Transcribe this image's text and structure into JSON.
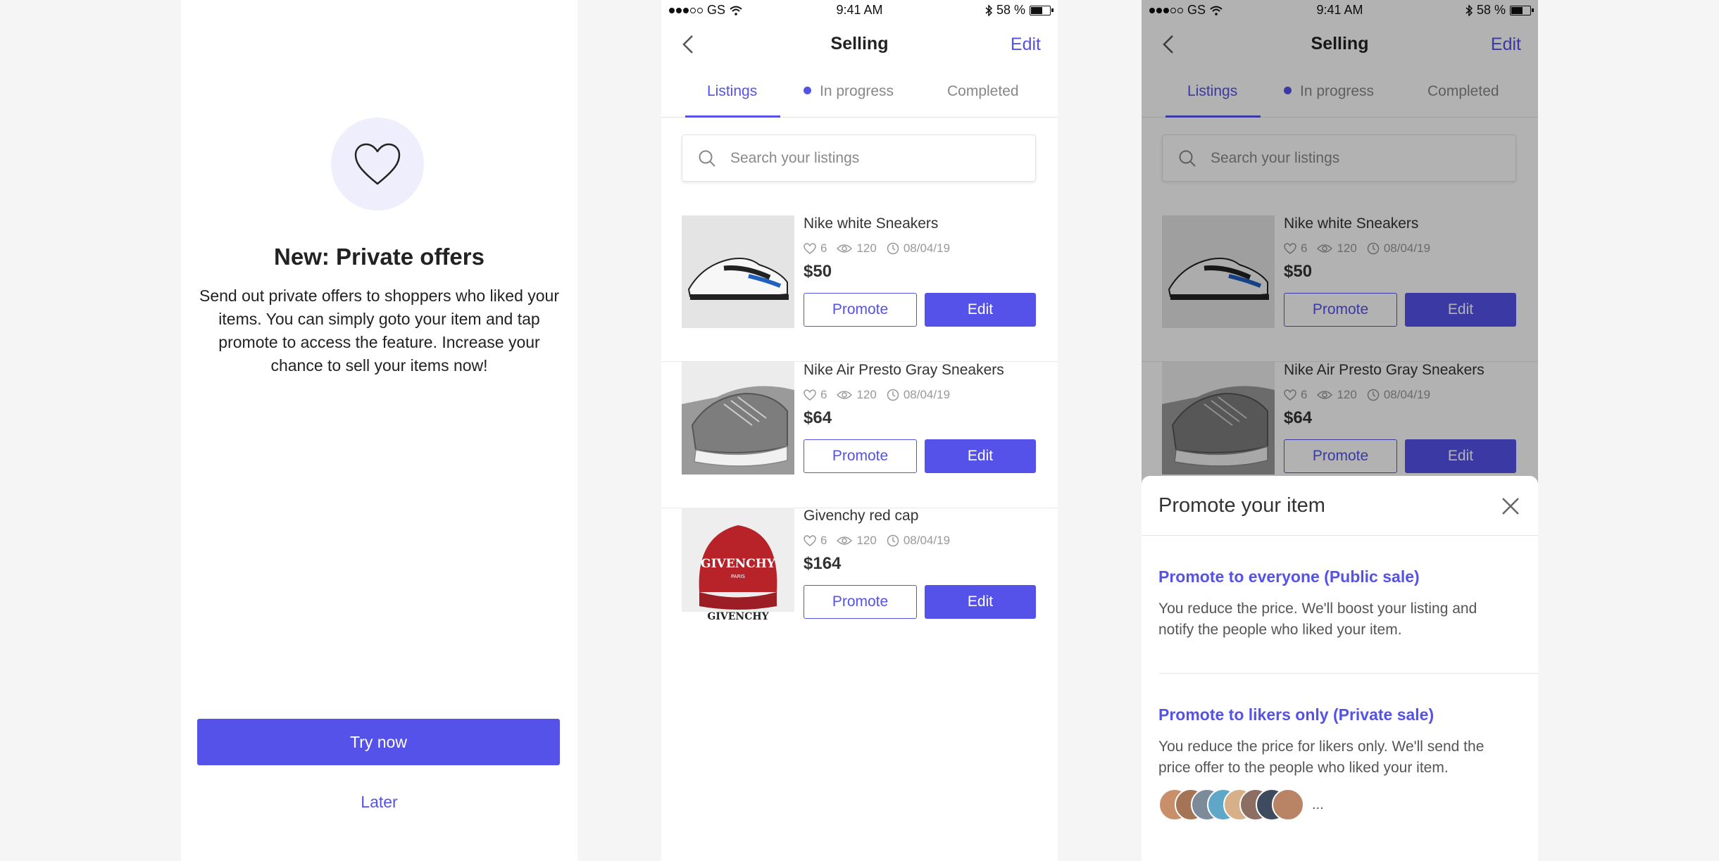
{
  "screen1": {
    "title": "New: Private offers",
    "body": "Send out private offers to shoppers who liked your items. You can simply goto your item and tap promote to access the feature. Increase your chance to sell your items now!",
    "primary_button": "Try now",
    "secondary_button": "Later",
    "icon": "heart-icon"
  },
  "status_bar": {
    "carrier": "GS",
    "time": "9:41 AM",
    "battery": "58 %",
    "battery_level": 0.58
  },
  "nav": {
    "title": "Selling",
    "edit": "Edit"
  },
  "tabs": [
    {
      "label": "Listings",
      "active": true
    },
    {
      "label": "In progress",
      "active": false
    },
    {
      "label": "Completed",
      "active": false
    }
  ],
  "search": {
    "placeholder": "Search your listings"
  },
  "listings": [
    {
      "name": "Nike white Sneakers",
      "likes": "6",
      "views": "120",
      "date": "08/04/19",
      "price": "$50",
      "promote": "Promote",
      "edit": "Edit"
    },
    {
      "name": "Nike Air Presto Gray Sneakers",
      "likes": "6",
      "views": "120",
      "date": "08/04/19",
      "price": "$64",
      "promote": "Promote",
      "edit": "Edit"
    },
    {
      "name": "Givenchy red cap",
      "likes": "6",
      "views": "120",
      "date": "08/04/19",
      "price": "$164",
      "promote": "Promote",
      "edit": "Edit",
      "cap_text": "GIVENCHY",
      "cap_sub": "PARIS"
    }
  ],
  "promote_sheet": {
    "title": "Promote your item",
    "options": [
      {
        "title": "Promote to everyone (Public sale)",
        "description": "You reduce the price. We'll boost your listing and notify the people who liked your item."
      },
      {
        "title": "Promote to likers only (Private sale)",
        "description": "You reduce the price for likers only. We'll send the price offer to the people who liked your item."
      }
    ],
    "more": "..."
  },
  "colors": {
    "accent": "#5552ea",
    "icon_bg": "#eeeefc",
    "cap_red": "#b8232a"
  }
}
